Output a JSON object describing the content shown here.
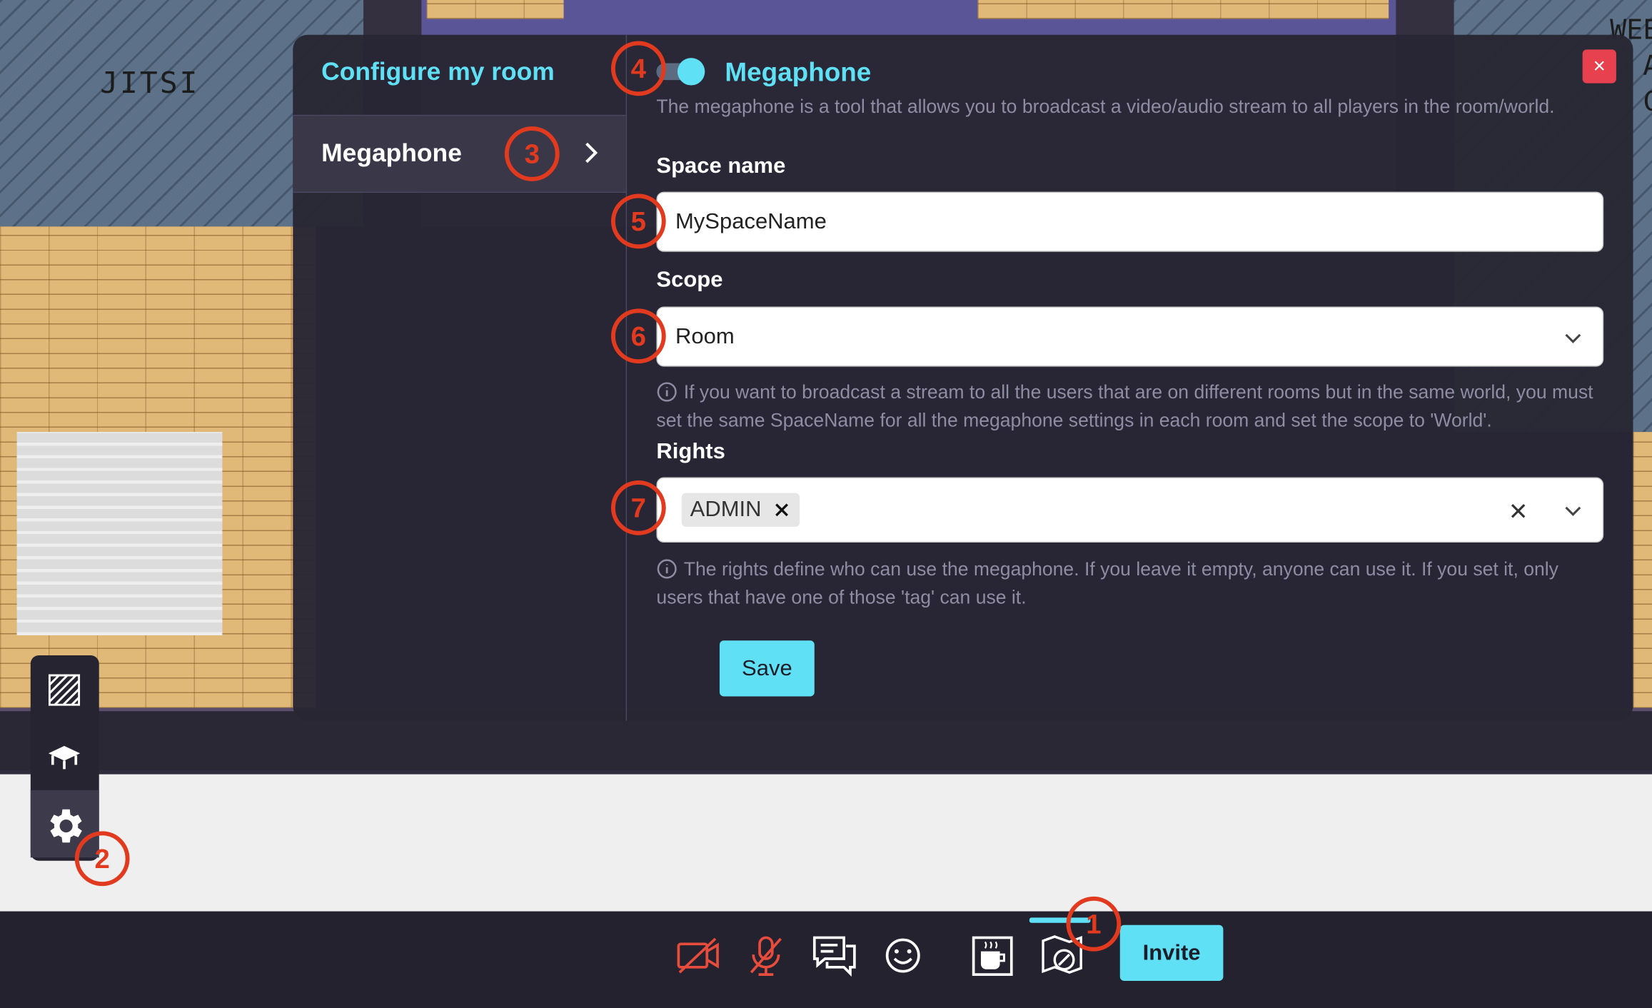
{
  "map": {
    "jitsi_label": "JITSI",
    "right_letters": [
      "WEE",
      "A",
      "C"
    ]
  },
  "modal": {
    "side_title": "Configure my room",
    "side_item": "Megaphone",
    "close": "×",
    "megaphone": {
      "title": "Megaphone",
      "enabled": true,
      "description": "The megaphone is a tool that allows you to broadcast a video/audio stream to all players in the room/world."
    },
    "space_name": {
      "label": "Space name",
      "value": "MySpaceName"
    },
    "scope": {
      "label": "Scope",
      "value": "Room",
      "hint": "If you want to broadcast a stream to all the users that are on different rooms but in the same world, you must set the same SpaceName for all the megaphone settings in each room and set the scope to 'World'."
    },
    "rights": {
      "label": "Rights",
      "tags": [
        "ADMIN"
      ],
      "hint": "The rights define who can use the megaphone. If you leave it empty, anyone can use it. If you set it, only users that have one of those 'tag' can use it."
    },
    "save_label": "Save"
  },
  "annotations": [
    "1",
    "2",
    "3",
    "4",
    "5",
    "6",
    "7"
  ],
  "bottombar": {
    "invite_label": "Invite",
    "icons": [
      "camera-off-icon",
      "microphone-off-icon",
      "chat-icon",
      "emoji-icon",
      "coffee-break-icon",
      "map-editor-icon"
    ]
  },
  "colors": {
    "accent": "#5fe0f5",
    "annotation": "#e23a1e",
    "close": "#e7404f",
    "muted": "#e74c3c"
  }
}
